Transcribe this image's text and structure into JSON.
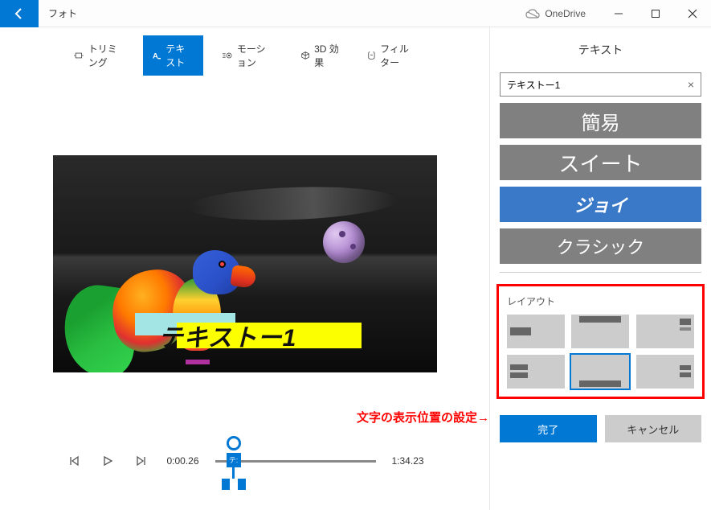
{
  "titlebar": {
    "app_name": "フォト",
    "onedrive_label": "OneDrive"
  },
  "toolbar": {
    "trim": "トリミング",
    "text": "テキスト",
    "motion": "モーション",
    "effect3d": "3D 効果",
    "filter": "フィルター"
  },
  "preview": {
    "overlay_text": "テキストー1",
    "annotation": "文字の表示位置の設定→"
  },
  "controls": {
    "current_time": "0:00.26",
    "total_time": "1:34.23",
    "playhead_marker": "テ:"
  },
  "right_panel": {
    "title": "テキスト",
    "text_value": "テキストー1",
    "styles": {
      "simple": "簡易",
      "sweet": "スイート",
      "joy": "ジョイ",
      "classic": "クラシック"
    },
    "layout_title": "レイアウト",
    "done": "完了",
    "cancel": "キャンセル"
  }
}
